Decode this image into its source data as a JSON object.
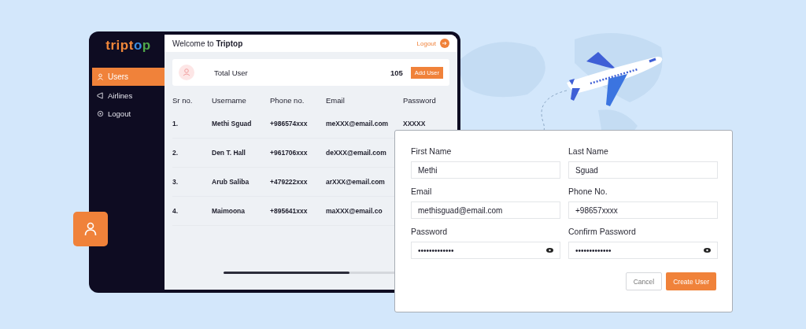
{
  "sidebar": {
    "logo": "triptop",
    "items": [
      {
        "label": "Users",
        "selected": true
      },
      {
        "label": "Airlines",
        "selected": false
      },
      {
        "label": "Logout",
        "selected": false
      }
    ]
  },
  "header": {
    "title": "Welcome to **Triptop**",
    "logout": "Logout"
  },
  "summary": {
    "label": "Total User",
    "count": "105",
    "button": "Add User"
  },
  "table": {
    "columns": [
      "Sr no.",
      "Username",
      "Phone no.",
      "Email",
      "Password"
    ],
    "rows": [
      {
        "sr": "1.",
        "username": "Methi Sguad",
        "phone": "+986574xxx",
        "email": "meXXX@email.com",
        "password": "XXXXX"
      },
      {
        "sr": "2.",
        "username": "Den T. Hall",
        "phone": "+961706xxx",
        "email": "deXXX@email.com"
      },
      {
        "sr": "3.",
        "username": "Arub Saliba",
        "phone": "+479222xxx",
        "email": "arXXX@email.com"
      },
      {
        "sr": "4.",
        "username": "Maimoona",
        "phone": "+895641xxx",
        "email": "maXXX@email.co"
      }
    ]
  },
  "form": {
    "fields": [
      {
        "label": "First Name",
        "value": "Methi",
        "kind": "text"
      },
      {
        "label": "Last Name",
        "value": "Sguad",
        "kind": "text"
      },
      {
        "label": "Email",
        "value": "methisguad@email.com",
        "kind": "text"
      },
      {
        "label": "Phone No.",
        "value": "+98657xxxx",
        "kind": "text"
      },
      {
        "label": "Password",
        "value": "•••••••••••••",
        "kind": "password"
      },
      {
        "label": "Confirm Password",
        "value": "•••••••••••••",
        "kind": "password"
      }
    ],
    "buttons": [
      {
        "label": "Cancel",
        "kind": "secondary"
      },
      {
        "label": "Create User",
        "kind": "primary"
      }
    ]
  }
}
